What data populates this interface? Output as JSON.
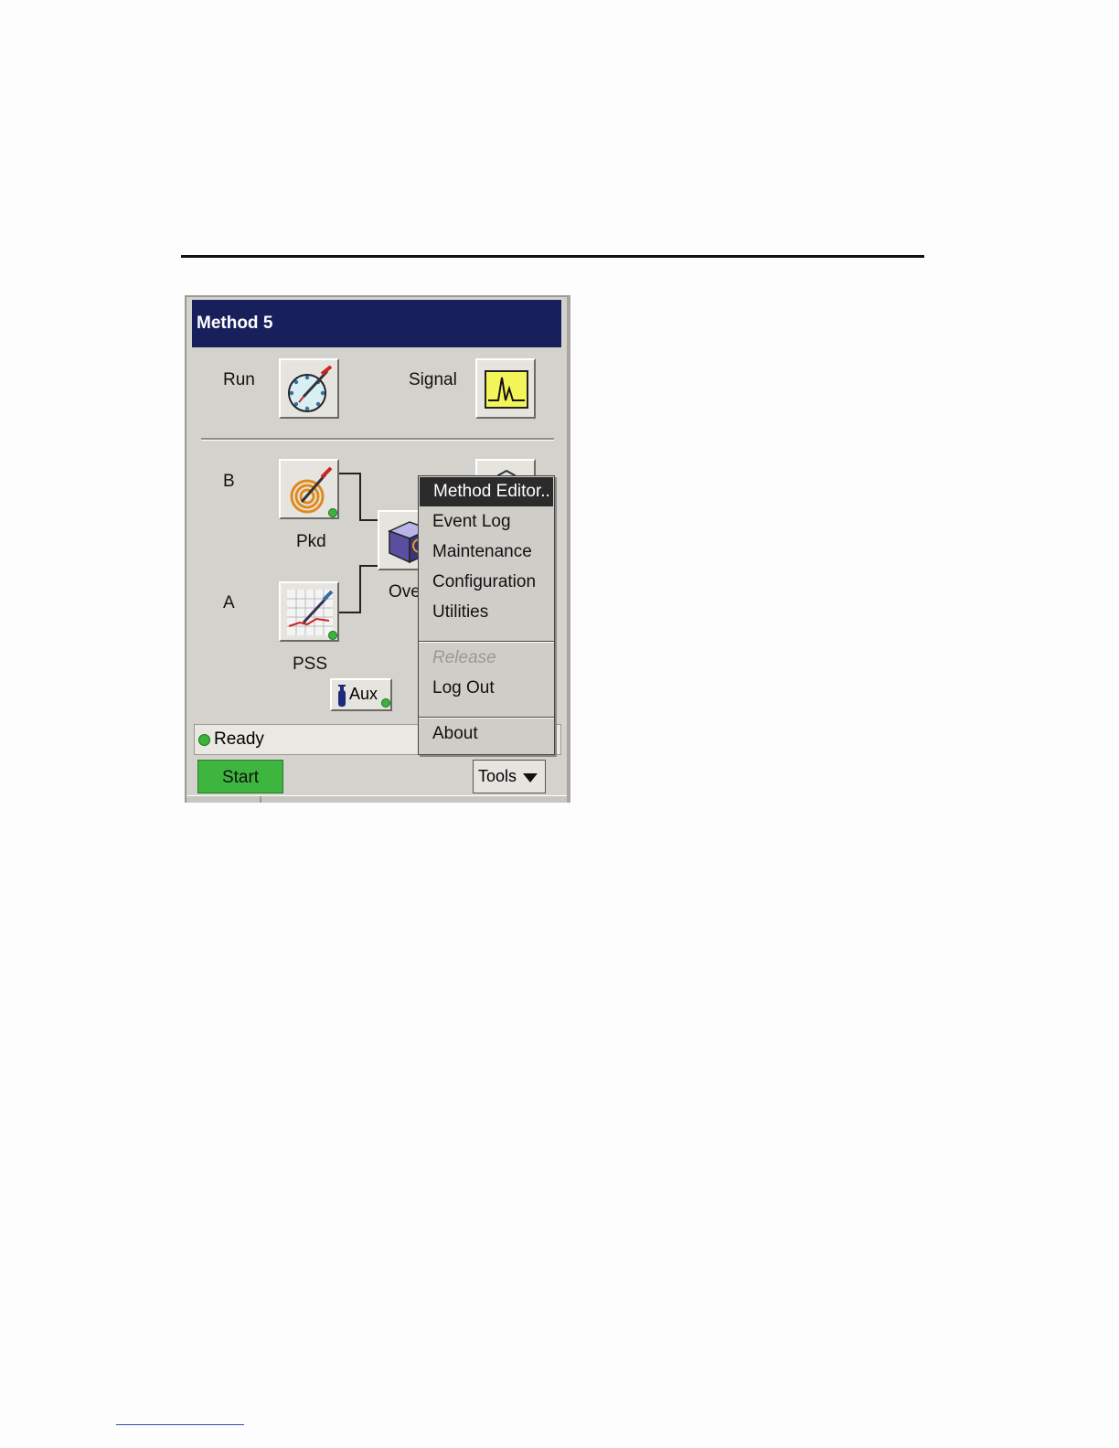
{
  "window": {
    "title": "Method 5"
  },
  "run": {
    "label": "Run"
  },
  "signal": {
    "label": "Signal"
  },
  "channels": {
    "b_label": "B",
    "a_label": "A"
  },
  "modules": {
    "pkd_label": "Pkd",
    "pss_label": "PSS",
    "oven_label": "Ove",
    "aux_label": "Aux"
  },
  "status": {
    "text": "Ready",
    "color": "#3cb43c"
  },
  "buttons": {
    "start_label": "Start",
    "tools_label": "Tools"
  },
  "tools_menu": {
    "items": [
      {
        "label": "Method Editor..",
        "selected": true,
        "enabled": true
      },
      {
        "label": "Event Log",
        "enabled": true
      },
      {
        "label": "Maintenance",
        "enabled": true
      },
      {
        "label": "Configuration",
        "enabled": true
      },
      {
        "label": "Utilities",
        "enabled": true
      },
      {
        "label": "Release",
        "enabled": false
      },
      {
        "label": "Log Out",
        "enabled": true
      },
      {
        "label": "About",
        "enabled": true
      }
    ]
  },
  "colors": {
    "titlebar": "#18205c",
    "start_button": "#3eb53e",
    "signal_icon_bg": "#f3f35a",
    "status_dot": "#3cb43c"
  }
}
